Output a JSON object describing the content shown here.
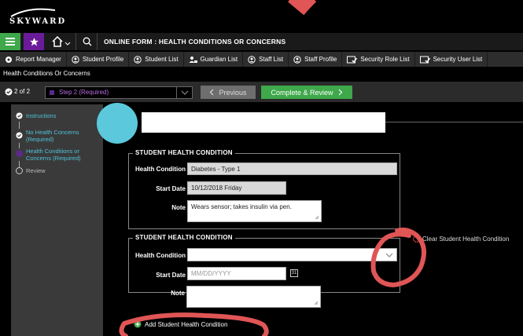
{
  "app": {
    "logo": "SKYWARD"
  },
  "nav": {
    "form_title": "ONLINE FORM : HEALTH CONDITIONS OR CONCERNS"
  },
  "toolbar": {
    "items": [
      {
        "label": "Report Manager",
        "icon": "gear-icon"
      },
      {
        "label": "Student Profile",
        "icon": "student-profile-icon"
      },
      {
        "label": "Student List",
        "icon": "student-list-icon"
      },
      {
        "label": "Guardian List",
        "icon": "guardian-icon"
      },
      {
        "label": "Staff List",
        "icon": "staff-list-icon"
      },
      {
        "label": "Staff Profile",
        "icon": "staff-profile-icon"
      },
      {
        "label": "Security Role List",
        "icon": "security-role-icon"
      },
      {
        "label": "Security User List",
        "icon": "security-user-icon"
      }
    ]
  },
  "breadcrumb": "Health Conditions Or Concerns",
  "steps": {
    "count": "2 of 2",
    "selected": "Step 2 (Required)",
    "previous_label": "Previous",
    "complete_label": "Complete & Review"
  },
  "sidebar": {
    "items": [
      {
        "label": "Instructions",
        "state": "complete"
      },
      {
        "label": "No Health Concerns (Required)",
        "state": "complete"
      },
      {
        "label": "Health Conditions or Concerns (Required)",
        "state": "current"
      },
      {
        "label": "Review",
        "state": "pending"
      }
    ]
  },
  "section1": {
    "title": "STUDENT HEALTH CONDITION",
    "health_condition_label": "Health Condition",
    "health_condition_value": "Diabetes - Type 1",
    "start_date_label": "Start Date",
    "start_date_value": "10/12/2018 Friday",
    "note_label": "Note",
    "note_value": "Wears sensor; takes insulin via pen."
  },
  "section2": {
    "title": "STUDENT HEALTH CONDITION",
    "clear_label": "Clear Student Health Condition",
    "health_condition_label": "Health Condition",
    "health_condition_value": "",
    "start_date_label": "Start Date",
    "start_date_placeholder": "MM/DD/YYYY",
    "calendar_day": "31",
    "note_label": "Note",
    "note_value": ""
  },
  "add_label": "Add Student Health Condition",
  "colors": {
    "accent_green": "#3ea84a",
    "accent_purple": "#6a1b9a",
    "sidebar_text": "#4fc3d9",
    "annotation_red": "#e05555",
    "highlight_cyan": "#5bc8dc"
  }
}
